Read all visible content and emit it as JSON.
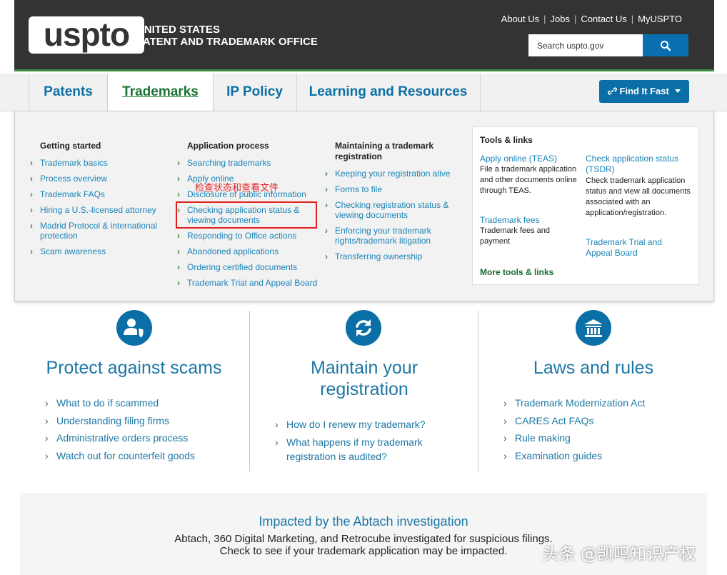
{
  "header": {
    "logo": "uspto",
    "agency_line1": "UNITED STATES",
    "agency_line2": "PATENT AND TRADEMARK OFFICE",
    "top_links": [
      "About Us",
      "Jobs",
      "Contact Us",
      "MyUSPTO"
    ],
    "search_placeholder": "Search uspto.gov",
    "search_icon": "search-icon"
  },
  "nav": {
    "tabs": [
      "Patents",
      "Trademarks",
      "IP Policy",
      "Learning and Resources"
    ],
    "active_tab": "Trademarks",
    "find_fast": "Find It Fast"
  },
  "mega_menu": {
    "getting_started": {
      "heading": "Getting started",
      "links": [
        "Trademark basics",
        "Process overview",
        "Trademark FAQs",
        "Hiring a U.S.-licensed attorney",
        "Madrid Protocol & international protection",
        "Scam awareness"
      ]
    },
    "application_process": {
      "heading": "Application process",
      "links": [
        "Searching trademarks",
        "Apply online",
        "Disclosure of public information",
        "Checking application status & viewing documents",
        "Responding to Office actions",
        "Abandoned applications",
        "Ordering certified documents",
        "Trademark Trial and Appeal Board"
      ]
    },
    "maintaining": {
      "heading": "Maintaining a trademark registration",
      "links": [
        "Keeping your registration alive",
        "Forms to file",
        "Checking registration status & viewing documents",
        "Enforcing your trademark rights/trademark litigation",
        "Transferring ownership"
      ]
    },
    "tools": {
      "heading": "Tools & links",
      "teas_link": "Apply online (TEAS)",
      "teas_desc": "File a trademark application and other documents online through TEAS.",
      "fees_link": "Trademark fees",
      "fees_desc": "Trademark fees and payment",
      "tsdr_link": "Check application status (TSDR)",
      "tsdr_desc": "Check trademark application status and view all documents associated with an application/registration.",
      "ttab_link": "Trademark Trial and Appeal Board",
      "more_link": "More tools & links"
    },
    "annotation": "检查状态和查看文件"
  },
  "features": [
    {
      "title": "Protect against scams",
      "icon": "user-shield-icon",
      "links": [
        "What to do if scammed",
        "Understanding filing firms",
        "Administrative orders process",
        "Watch out for counterfeit goods"
      ]
    },
    {
      "title": "Maintain your registration",
      "icon": "refresh-icon",
      "links": [
        "How do I renew my trademark?",
        "What happens if my trademark registration is audited?"
      ]
    },
    {
      "title": "Laws and rules",
      "icon": "courthouse-icon",
      "links": [
        "Trademark Modernization Act",
        "CARES Act FAQs",
        "Rule making",
        "Examination guides"
      ]
    }
  ],
  "banner": {
    "title": "Impacted by the Abtach investigation",
    "line1": "Abtach, 360 Digital Marketing, and Retrocube investigated for suspicious filings.",
    "line2": "Check to see if your trademark application may be impacted."
  },
  "watermark": "头条 @凯鸣知识产权",
  "colors": {
    "header_bg": "#333333",
    "link_blue": "#1a84b8",
    "brand_blue": "#0a6fa6",
    "accent_green": "#3a8a3c",
    "annotation_red": "#e22020"
  }
}
